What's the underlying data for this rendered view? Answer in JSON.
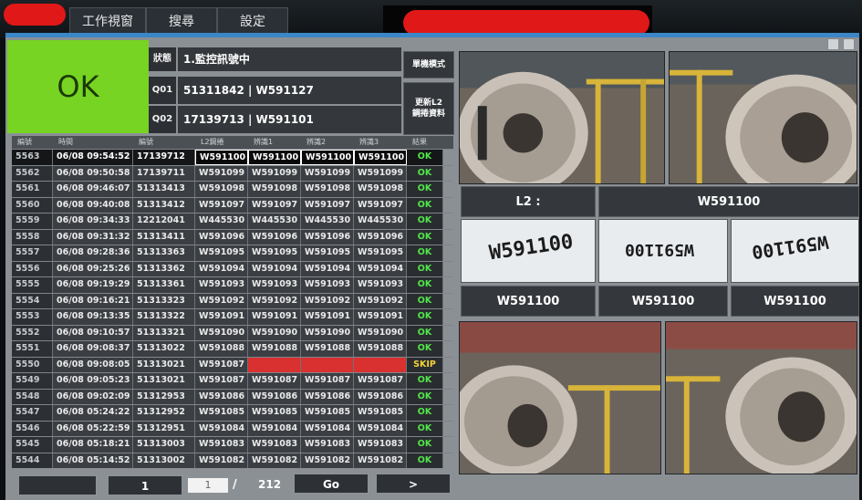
{
  "menu": {
    "tabs": [
      "工作視窗",
      "搜尋",
      "設定"
    ]
  },
  "status": {
    "result": "OK",
    "state_label": "狀態",
    "state_value": "1.監控訊號中",
    "q01_label": "Q01",
    "q01_value": "51311842 | W591127",
    "q02_label": "Q02",
    "q02_value": "17139713 | W591101",
    "mode_button": "單機模式",
    "update_button_line1": "更新L2",
    "update_button_line2": "鋼捲資料"
  },
  "table": {
    "headers": [
      "編號",
      "時間",
      "編號",
      "L2鋼捲",
      "辨識1",
      "辨識2",
      "辨識3",
      "結果"
    ],
    "rows": [
      [
        "5563",
        "06/08 09:54:52",
        "17139712",
        "W591100",
        "W591100",
        "W591100",
        "W591100",
        "OK"
      ],
      [
        "5562",
        "06/08 09:50:58",
        "17139711",
        "W591099",
        "W591099",
        "W591099",
        "W591099",
        "OK"
      ],
      [
        "5561",
        "06/08 09:46:07",
        "51313413",
        "W591098",
        "W591098",
        "W591098",
        "W591098",
        "OK"
      ],
      [
        "5560",
        "06/08 09:40:08",
        "51313412",
        "W591097",
        "W591097",
        "W591097",
        "W591097",
        "OK"
      ],
      [
        "5559",
        "06/08 09:34:33",
        "12212041",
        "W445530",
        "W445530",
        "W445530",
        "W445530",
        "OK"
      ],
      [
        "5558",
        "06/08 09:31:32",
        "51313411",
        "W591096",
        "W591096",
        "W591096",
        "W591096",
        "OK"
      ],
      [
        "5557",
        "06/08 09:28:36",
        "51313363",
        "W591095",
        "W591095",
        "W591095",
        "W591095",
        "OK"
      ],
      [
        "5556",
        "06/08 09:25:26",
        "51313362",
        "W591094",
        "W591094",
        "W591094",
        "W591094",
        "OK"
      ],
      [
        "5555",
        "06/08 09:19:29",
        "51313361",
        "W591093",
        "W591093",
        "W591093",
        "W591093",
        "OK"
      ],
      [
        "5554",
        "06/08 09:16:21",
        "51313323",
        "W591092",
        "W591092",
        "W591092",
        "W591092",
        "OK"
      ],
      [
        "5553",
        "06/08 09:13:35",
        "51313322",
        "W591091",
        "W591091",
        "W591091",
        "W591091",
        "OK"
      ],
      [
        "5552",
        "06/08 09:10:57",
        "51313321",
        "W591090",
        "W591090",
        "W591090",
        "W591090",
        "OK"
      ],
      [
        "5551",
        "06/08 09:08:37",
        "51313022",
        "W591088",
        "W591088",
        "W591088",
        "W591088",
        "OK"
      ],
      [
        "5550",
        "06/08 09:08:05",
        "51313021",
        "W591087",
        "",
        "",
        "",
        "SKIP"
      ],
      [
        "5549",
        "06/08 09:05:23",
        "51313021",
        "W591087",
        "W591087",
        "W591087",
        "W591087",
        "OK"
      ],
      [
        "5548",
        "06/08 09:02:09",
        "51312953",
        "W591086",
        "W591086",
        "W591086",
        "W591086",
        "OK"
      ],
      [
        "5547",
        "06/08 05:24:22",
        "51312952",
        "W591085",
        "W591085",
        "W591085",
        "W591085",
        "OK"
      ],
      [
        "5546",
        "06/08 05:22:59",
        "51312951",
        "W591084",
        "W591084",
        "W591084",
        "W591084",
        "OK"
      ],
      [
        "5545",
        "06/08 05:18:21",
        "51313003",
        "W591083",
        "W591083",
        "W591083",
        "W591083",
        "OK"
      ],
      [
        "5544",
        "06/08 05:14:52",
        "51313002",
        "W591082",
        "W591082",
        "W591082",
        "W591082",
        "OK"
      ]
    ]
  },
  "pager": {
    "first": "1",
    "current": "1",
    "separator": "/",
    "total": "212",
    "go": "Go",
    "next": ">"
  },
  "recognition": {
    "l2_label": "L2 :",
    "l2_value": "W591100",
    "label_codes": [
      "W591100",
      "W591100",
      "W591100"
    ],
    "ocr_results": [
      "W591100",
      "W591100",
      "W591100"
    ]
  },
  "colors": {
    "ok_green": "#77d423",
    "skip_yellow": "#f0d23a",
    "error_red": "#d93030",
    "accent_blue": "#3b87c7"
  }
}
